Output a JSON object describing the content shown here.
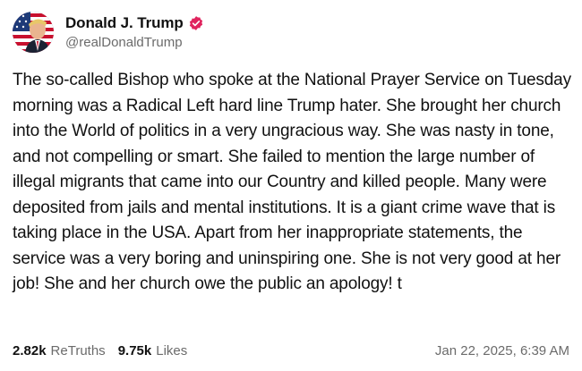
{
  "post": {
    "author": {
      "display_name": "Donald J. Trump",
      "handle": "@realDonaldTrump",
      "verified_icon": "verified-badge-icon"
    },
    "text": "The so-called Bishop who spoke at the National Prayer Service on Tuesday morning was a Radical Left hard line Trump hater. She brought her church into the World of politics in a very ungracious way. She was nasty in tone, and not compelling or smart. She failed to mention the large number of illegal migrants that came into our Country and killed people. Many were deposited from jails and mental institutions. It is a giant crime wave that is taking place in the USA. Apart from her inappropriate statements, the service was a very boring and uninspiring one. She is not very good at her job! She and her church owe the public an apology! t",
    "stats": {
      "retruths_count": "2.82k",
      "retruths_label": "ReTruths",
      "likes_count": "9.75k",
      "likes_label": "Likes"
    },
    "timestamp": "Jan 22, 2025, 6:39 AM"
  },
  "colors": {
    "verified_badge": "#e0245e",
    "muted_text": "#6b6b6b"
  }
}
